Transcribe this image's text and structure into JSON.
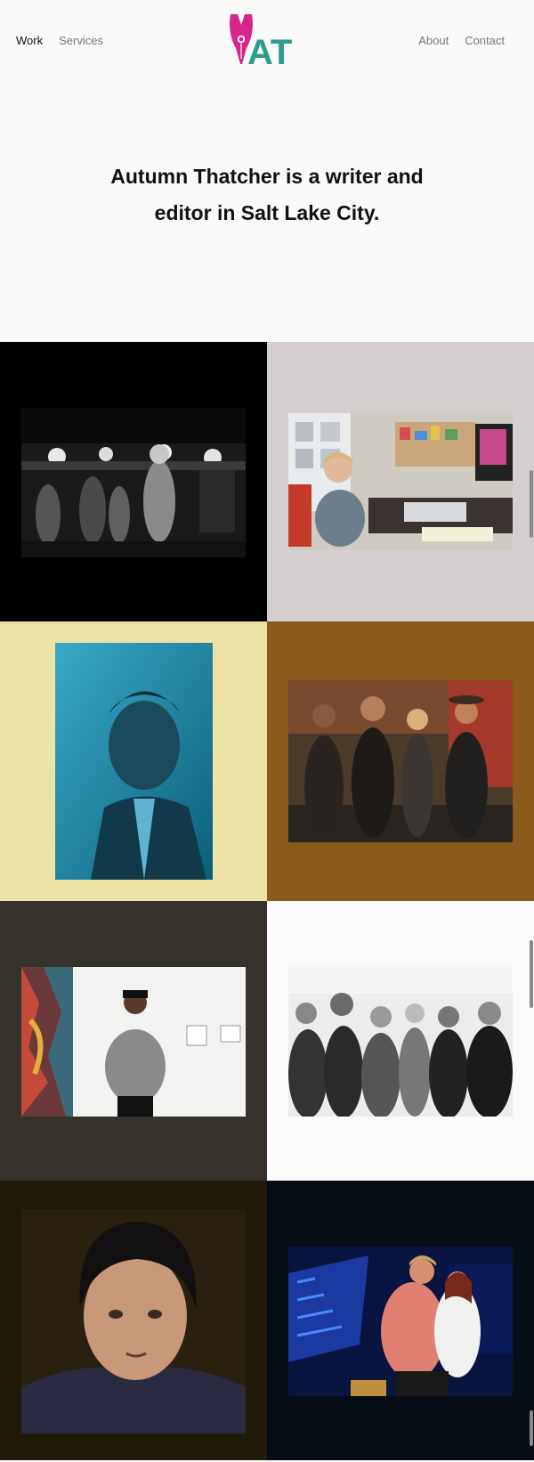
{
  "nav": {
    "left": [
      {
        "label": "Work",
        "active": true
      },
      {
        "label": "Services",
        "active": false
      }
    ],
    "right": [
      {
        "label": "About"
      },
      {
        "label": "Contact"
      }
    ]
  },
  "logo": {
    "text": "AT",
    "pen_color": "#d6258b",
    "text_color": "#2a9d8f"
  },
  "intro": {
    "line1": "Autumn Thatcher is a writer and",
    "line2": "editor in Salt Lake City."
  },
  "tiles": [
    {
      "name": "tile-metal-band-concert",
      "bg": "#000000",
      "description": "black-and-white live metal concert"
    },
    {
      "name": "tile-woman-office",
      "bg": "#d6cfd0",
      "description": "woman smiling at office desk"
    },
    {
      "name": "tile-man-blue-portrait",
      "bg": "#ede3a6",
      "description": "blue-tinted portrait of a man"
    },
    {
      "name": "tile-band-sunset",
      "bg": "#8a5a1a",
      "description": "four-piece band at sunset"
    },
    {
      "name": "tile-artist-gallery",
      "bg": "#36322c",
      "description": "man in cap posing in gallery"
    },
    {
      "name": "tile-band-bw",
      "bg": "#fbfbfb",
      "description": "black-and-white group photo of band"
    },
    {
      "name": "tile-musician-portrait",
      "bg": "#211a09",
      "description": "close portrait of dark-haired man"
    },
    {
      "name": "tile-dancers-stage",
      "bg": "#070d15",
      "description": "two dancers embracing on stage"
    }
  ]
}
